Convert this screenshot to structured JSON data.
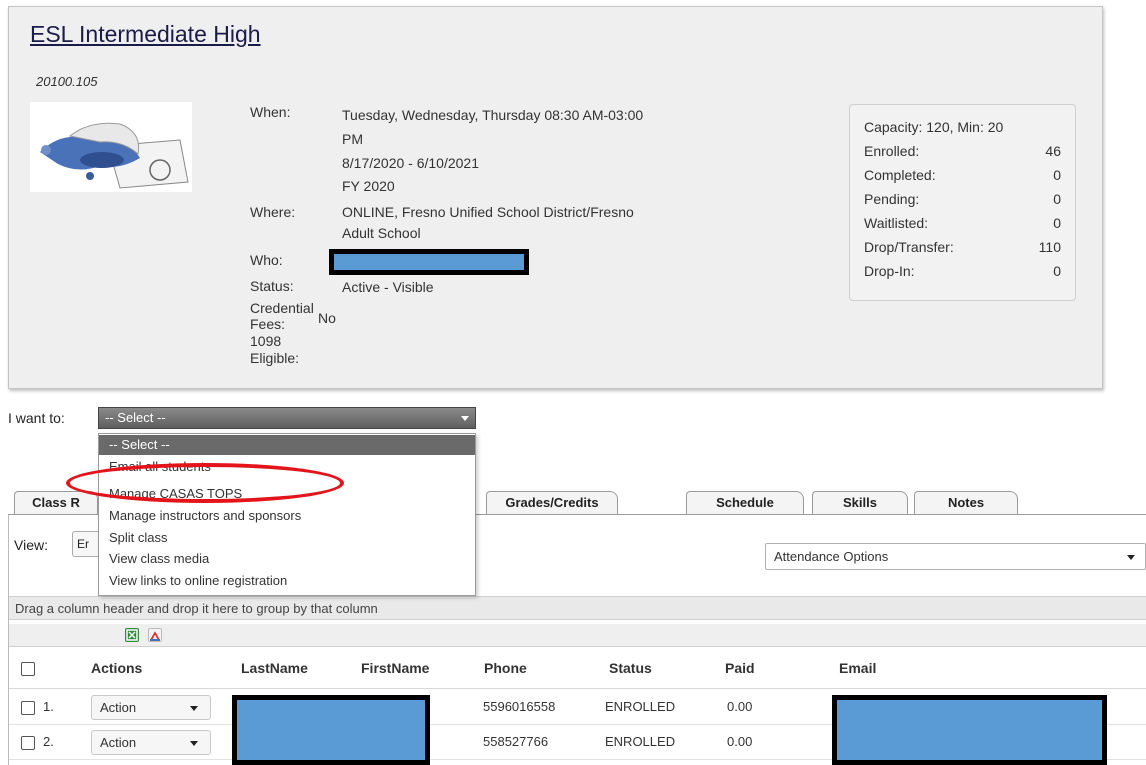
{
  "course": {
    "title": "ESL Intermediate High",
    "code": "20100.105"
  },
  "details": {
    "when_label": "When:",
    "when_line1": "Tuesday, Wednesday, Thursday 08:30 AM-03:00",
    "when_line2": "PM",
    "when_dates": "8/17/2020 - 6/10/2021",
    "when_fy": "FY 2020",
    "where_label": "Where:",
    "where_line1": "ONLINE, Fresno Unified School District/Fresno",
    "where_line2": "Adult School",
    "who_label": "Who:",
    "status_label": "Status:",
    "status_value": "Active - Visible",
    "credential_label_1": "Credential",
    "credential_label_2": "Fees:",
    "credential_value": "No",
    "eligible_label_1": "1098",
    "eligible_label_2": "Eligible:"
  },
  "stats": {
    "capacity": "Capacity: 120, Min: 20",
    "rows": [
      {
        "label": "Enrolled:",
        "value": "46"
      },
      {
        "label": "Completed:",
        "value": "0"
      },
      {
        "label": "Pending:",
        "value": "0"
      },
      {
        "label": "Waitlisted:",
        "value": "0"
      },
      {
        "label": "Drop/Transfer:",
        "value": "110"
      },
      {
        "label": "Drop-In:",
        "value": "0"
      }
    ]
  },
  "iwant": {
    "label": "I want to:",
    "selected": "-- Select --",
    "options": [
      "-- Select --",
      "Email all students",
      "Manage CASAS TOPS",
      "Manage instructors and sponsors",
      "Split class",
      "View class media",
      "View links to online registration"
    ]
  },
  "tabs": [
    "Class R",
    "Grades/Credits",
    "Schedule",
    "Skills",
    "Notes"
  ],
  "grid": {
    "view_label": "View:",
    "view_value": "Er",
    "attendance_options": "Attendance Options",
    "group_hint": "Drag a column header and drop it here to group by that column",
    "headers": [
      "Actions",
      "LastName",
      "FirstName",
      "Phone",
      "Status",
      "Paid",
      "Email"
    ],
    "rows": [
      {
        "num": "1.",
        "action": "Action",
        "phone": "5596016558",
        "status": "ENROLLED",
        "paid": "0.00"
      },
      {
        "num": "2.",
        "action": "Action",
        "phone": "558527766",
        "status": "ENROLLED",
        "paid": "0.00"
      }
    ]
  },
  "colors": {
    "redaction": "#5b9bd5",
    "highlight_circle": "#e4141b",
    "title": "#1b1b4a"
  }
}
